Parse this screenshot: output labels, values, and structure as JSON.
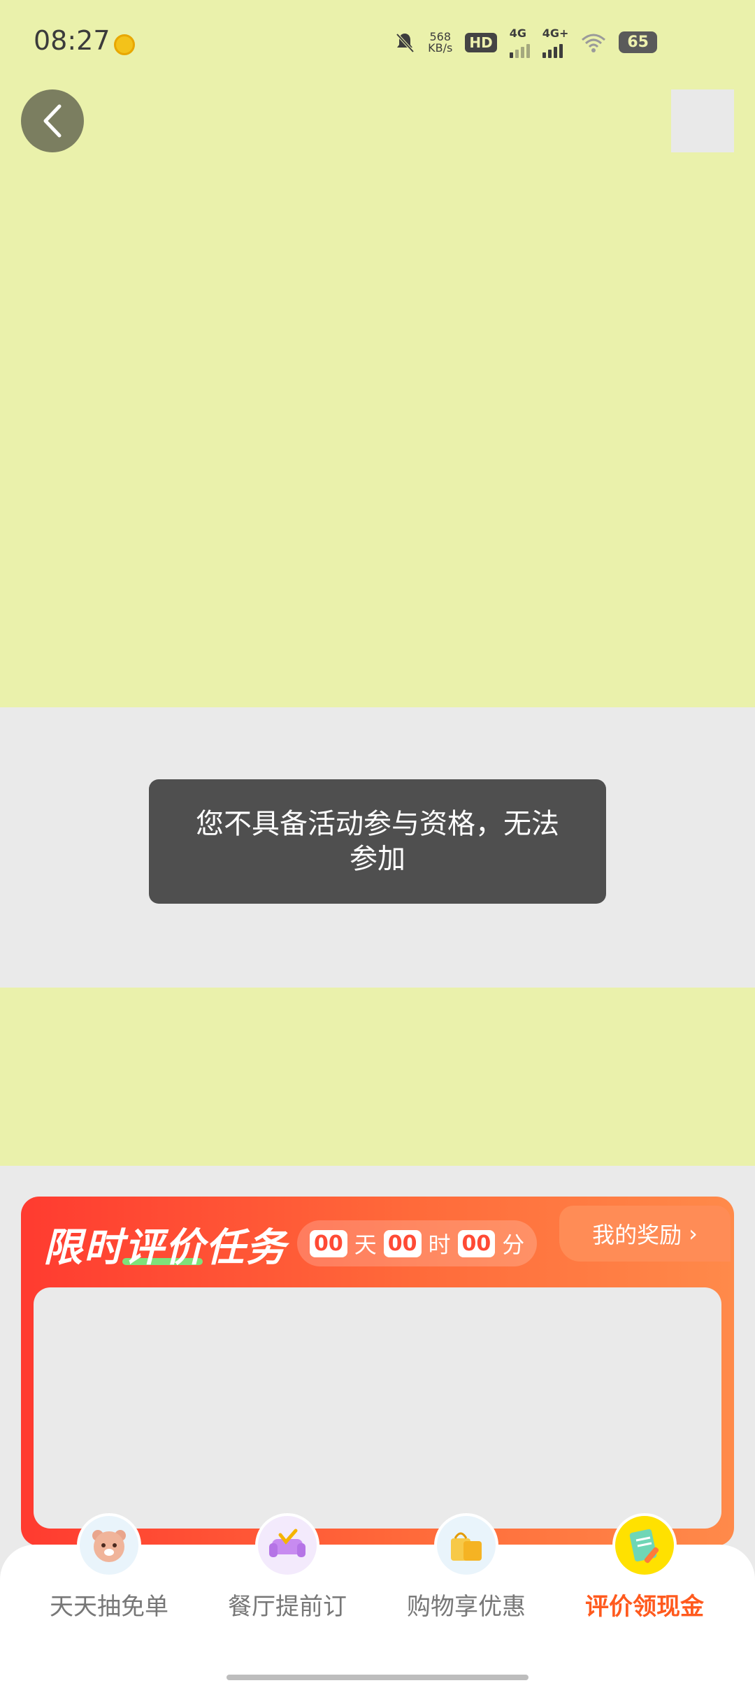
{
  "status_bar": {
    "time": "08:27",
    "speed_value": "568",
    "speed_unit": "KB/s",
    "hd_label": "HD",
    "net1": "4G",
    "net2": "4G+",
    "battery": "65"
  },
  "toast": {
    "message": "您不具备活动参与资格，无法参加"
  },
  "task_card": {
    "title": "限时评价任务",
    "countdown": {
      "days_value": "00",
      "days_unit": "天",
      "hours_value": "00",
      "hours_unit": "时",
      "minutes_value": "00",
      "minutes_unit": "分"
    },
    "rewards_label": "我的奖励",
    "rewards_chevron": "›"
  },
  "bottom_nav": {
    "items": [
      {
        "label": "天天抽免单",
        "icon": "bear-icon"
      },
      {
        "label": "餐厅提前订",
        "icon": "sofa-icon"
      },
      {
        "label": "购物享优惠",
        "icon": "shopping-bag-icon"
      },
      {
        "label": "评价领现金",
        "icon": "review-notepad-icon",
        "active": true
      }
    ]
  },
  "colors": {
    "banner": "#eaf1ab",
    "accent": "#ff4a35",
    "active_nav": "#ff5a1e"
  }
}
